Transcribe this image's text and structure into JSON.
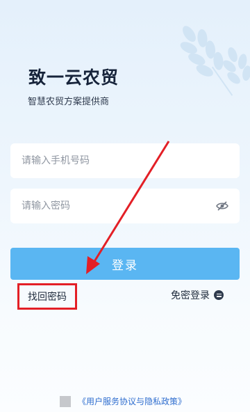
{
  "app": {
    "title": "致一云农贸",
    "subtitle": "智慧农贸方案提供商"
  },
  "form": {
    "phone_placeholder": "请输入手机号码",
    "phone_value": "",
    "password_placeholder": "请输入密码",
    "password_value": ""
  },
  "actions": {
    "login_label": "登录",
    "find_password_label": "找回密码",
    "code_login_label": "免密登录"
  },
  "footer": {
    "agreement_label": "《用户服务协议与隐私政策》",
    "agreement_checked": false
  },
  "icons": {
    "password_visibility": "eye-off-icon",
    "code_login": "menu-circle-icon",
    "decoration": "wheat-icon"
  },
  "colors": {
    "primary_button": "#5ab6f2",
    "highlight_box": "#e31f26",
    "annotation_arrow": "#e31f26",
    "link": "#2f6ecf"
  }
}
